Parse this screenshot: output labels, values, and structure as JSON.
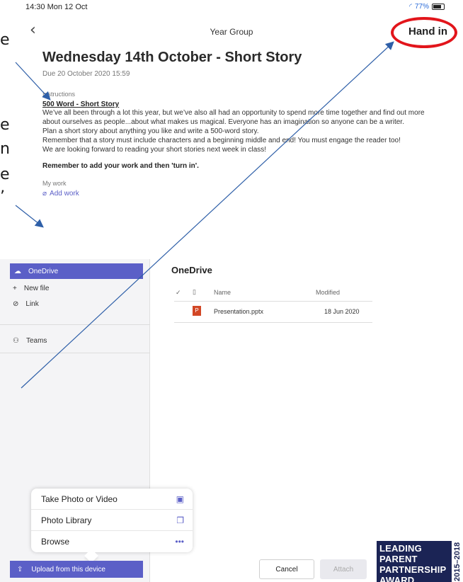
{
  "edge_chars": [
    "e",
    "e",
    "n",
    "e",
    "’"
  ],
  "status": {
    "time": "14:30 Mon 12 Oct",
    "battery": "77%"
  },
  "topbar": {
    "back_icon": "chevron-left-icon",
    "title": "Year Group",
    "hand_in": "Hand in"
  },
  "assignment": {
    "title": "Wednesday 14th October - Short Story",
    "due": "Due 20 October 2020 15:59",
    "instructions_label": "Instructions",
    "instructions_title": "500 Word - Short Story",
    "paragraphs": [
      "We’ve all been through a lot this year, but we’ve also all had an opportunity to spend more time together and find out more about ourselves as people...about what makes us magical. Everyone has an imagination so anyone can be a writer.",
      "Plan a short story about anything you like and write a 500-word story.",
      "Remember that a story must include characters and a beginning middle and end! You must engage the reader too!",
      " We are looking forward to reading your short stories next week in class!"
    ],
    "remember": "Remember to add your work and then 'turn in'.",
    "my_work_label": "My work",
    "add_work": "Add work"
  },
  "picker": {
    "sidebar": {
      "onedrive": "OneDrive",
      "new_file": "New file",
      "link": "Link",
      "teams": "Teams"
    },
    "content_title": "OneDrive",
    "columns": {
      "name": "Name",
      "modified": "Modified"
    },
    "files": [
      {
        "name": "Presentation.pptx",
        "modified": "18 Jun 2020"
      }
    ],
    "actionsheet": {
      "take_photo": "Take Photo or Video",
      "photo_library": "Photo Library",
      "browse": "Browse"
    },
    "upload": "Upload from this device",
    "cancel": "Cancel",
    "attach": "Attach"
  },
  "badge": {
    "line1": "LEADING",
    "line2": "PARENT",
    "line3": "PARTNERSHIP",
    "line4": "AWARD",
    "side": "2015–2018"
  },
  "colors": {
    "accent": "#5b5fc7",
    "annotation_arrow": "#2e5fa8",
    "highlight_ring": "#e2151b",
    "badge_bg": "#1b2455"
  }
}
